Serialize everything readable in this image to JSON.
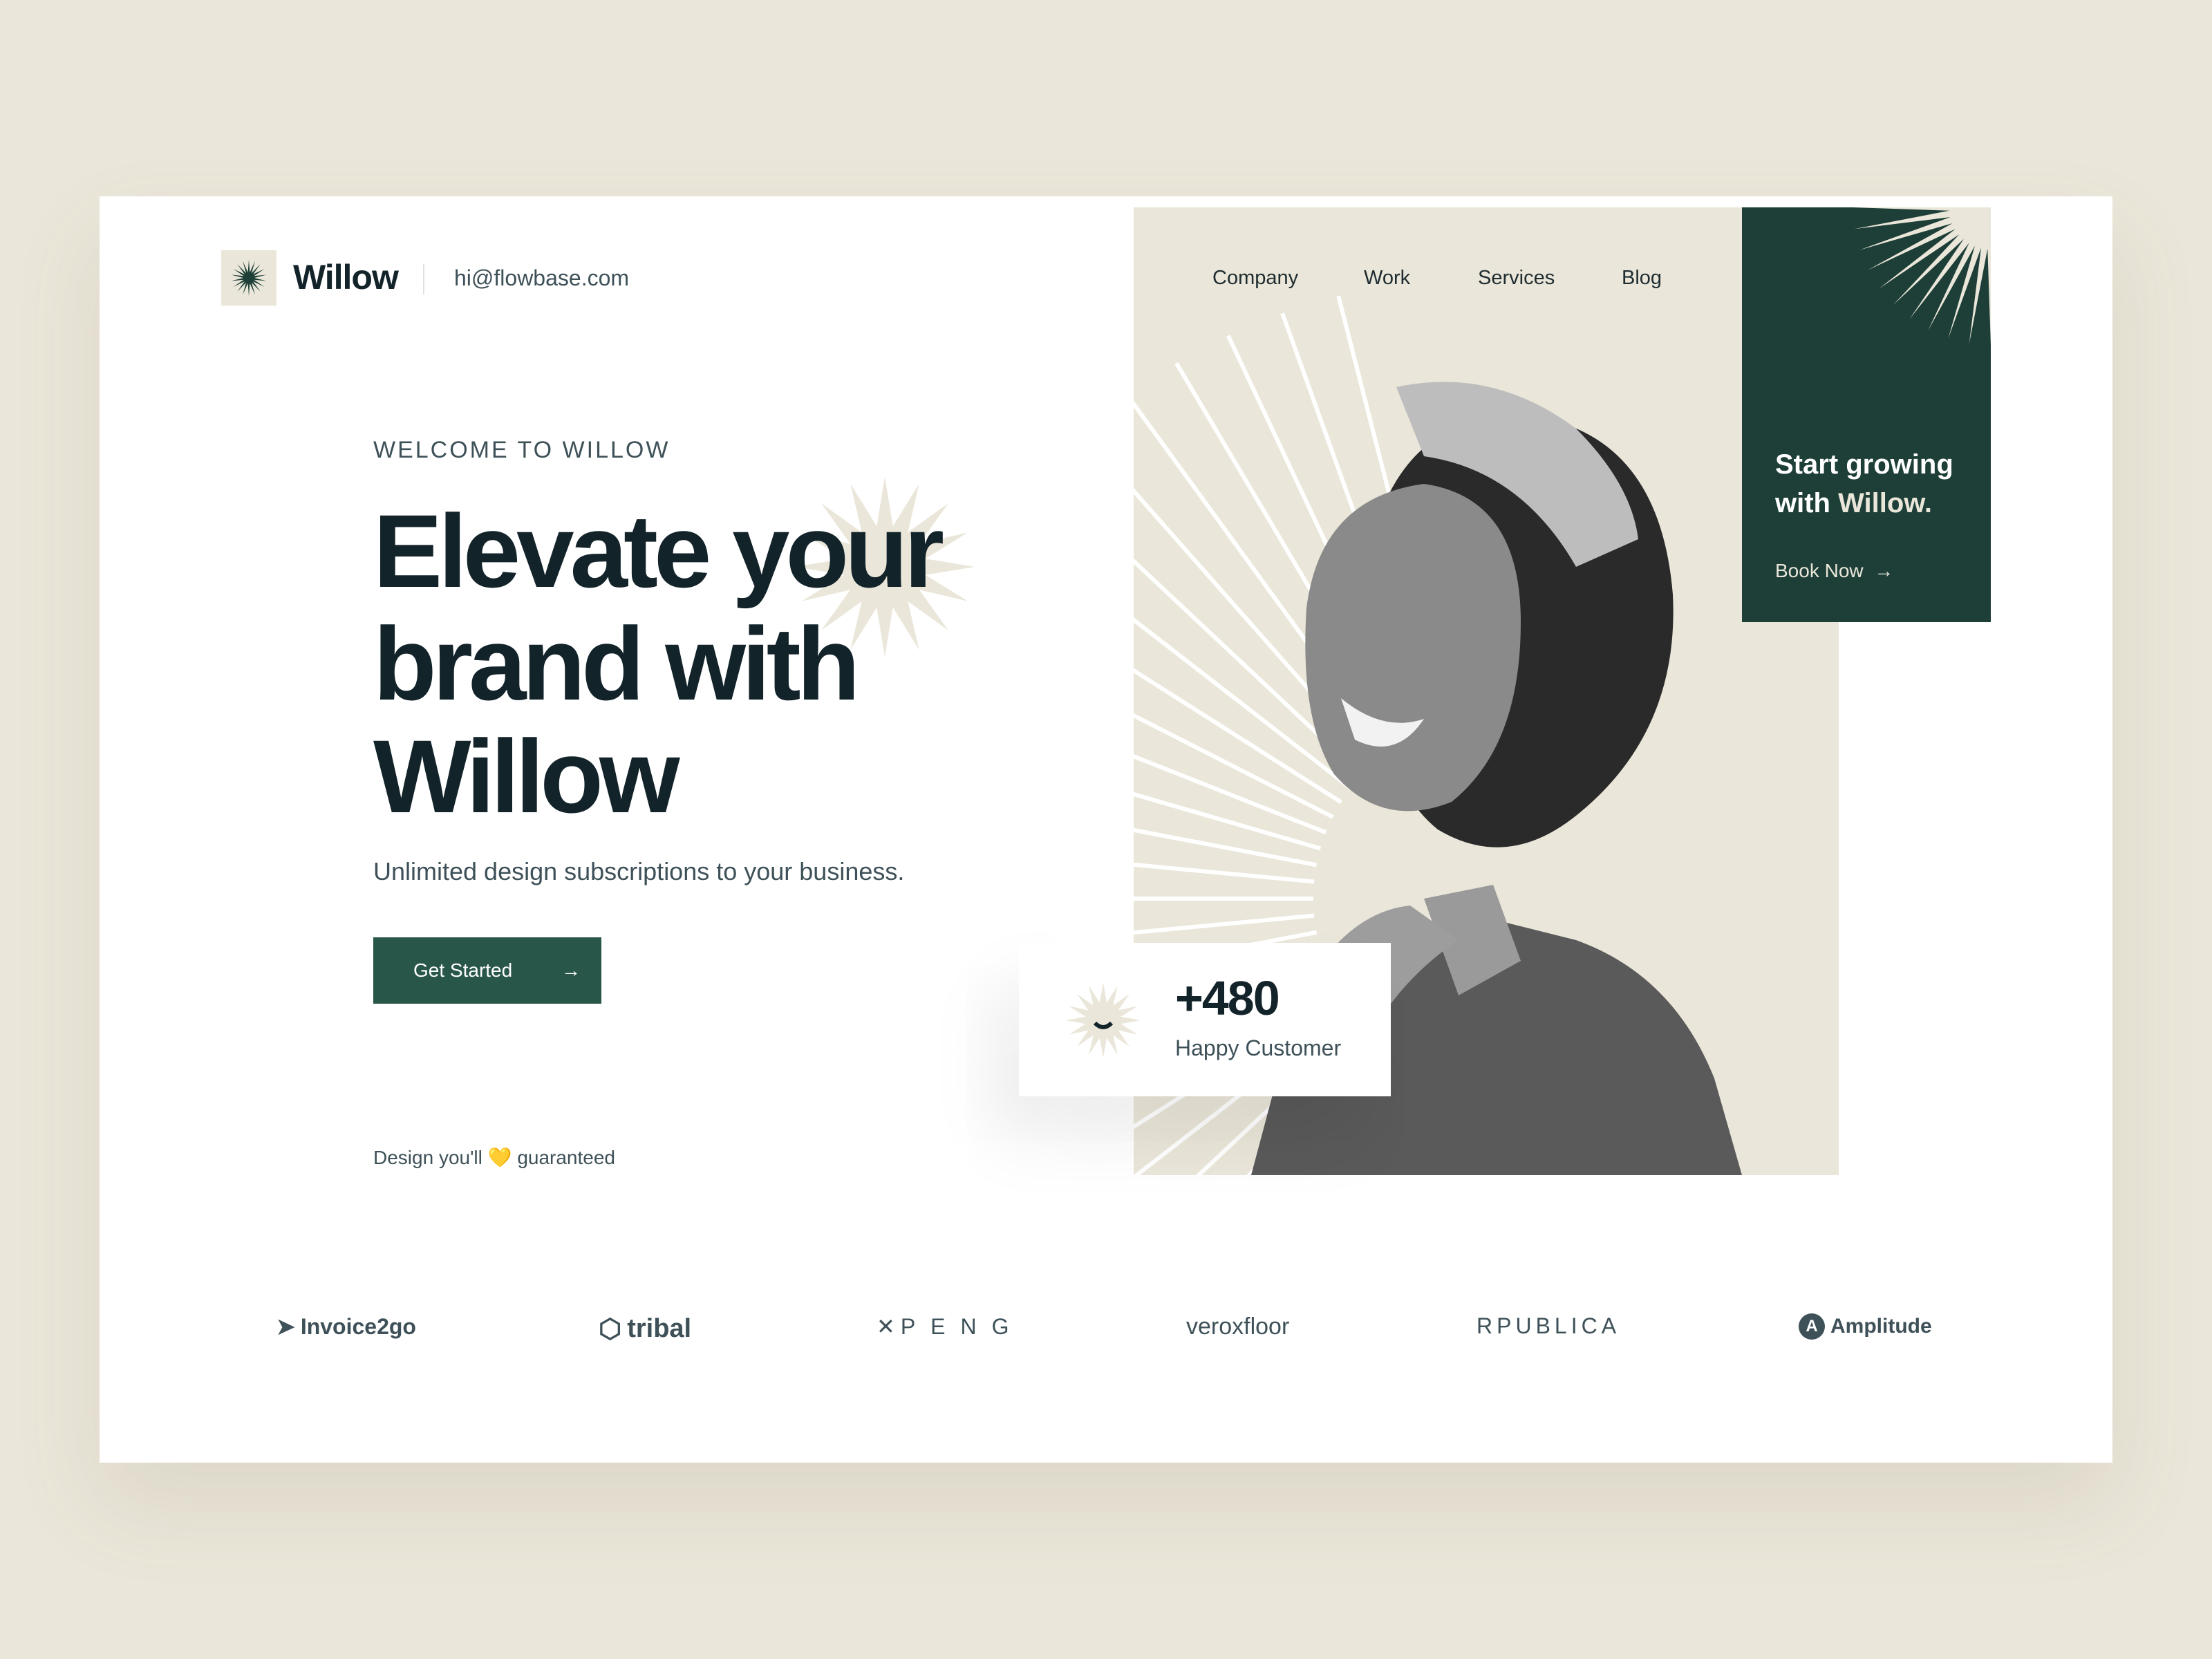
{
  "brand": {
    "name": "Willow",
    "email": "hi@flowbase.com"
  },
  "nav": [
    {
      "label": "Company"
    },
    {
      "label": "Work"
    },
    {
      "label": "Services"
    },
    {
      "label": "Blog"
    }
  ],
  "hero": {
    "eyebrow": "WELCOME TO WILLOW",
    "headline_lines": [
      "Elevate your",
      "brand with",
      "Willow"
    ],
    "subtitle": "Unlimited design subscriptions to your business.",
    "cta_label": "Get Started",
    "guarantee_pre": "Design you'll",
    "guarantee_emoji": "💛",
    "guarantee_post": "guaranteed"
  },
  "promo": {
    "line1": "Start growing",
    "line2_pre": "with",
    "line2_accent": "Willow.",
    "link": "Book Now"
  },
  "stat": {
    "value": "+480",
    "label": "Happy Customer"
  },
  "logos": [
    {
      "name": "Invoice2go"
    },
    {
      "name": "tribal"
    },
    {
      "name": "PENG"
    },
    {
      "name": "veroxfloor"
    },
    {
      "name": "RPUBLICA"
    },
    {
      "name": "Amplitude"
    }
  ],
  "colors": {
    "background": "#EAE6D9",
    "primary": "#1D3F38",
    "button": "#285649",
    "text": "#13232a"
  }
}
